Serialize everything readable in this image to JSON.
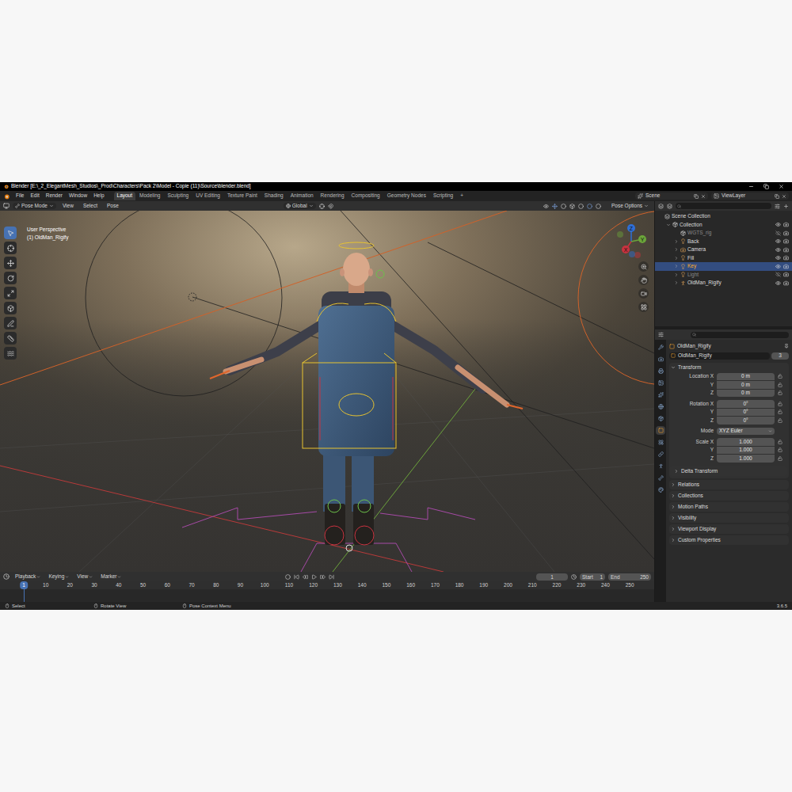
{
  "window": {
    "title": "Blender [E:\\_2_ElegantMesh_Studios\\_Prod\\Characters\\Pack 2\\Model - Copie (11)\\Source\\blender.blend]"
  },
  "top_bar": {
    "menus": [
      "File",
      "Edit",
      "Render",
      "Window",
      "Help"
    ],
    "workspaces": [
      {
        "label": "Layout",
        "selected": true
      },
      {
        "label": "Modeling",
        "selected": false
      },
      {
        "label": "Sculpting",
        "selected": false
      },
      {
        "label": "UV Editing",
        "selected": false
      },
      {
        "label": "Texture Paint",
        "selected": false
      },
      {
        "label": "Shading",
        "selected": false
      },
      {
        "label": "Animation",
        "selected": false
      },
      {
        "label": "Rendering",
        "selected": false
      },
      {
        "label": "Compositing",
        "selected": false
      },
      {
        "label": "Geometry Nodes",
        "selected": false
      },
      {
        "label": "Scripting",
        "selected": false
      }
    ],
    "add_workspace": "+",
    "scene": "Scene",
    "view_layer": "ViewLayer"
  },
  "viewport_header": {
    "mode": "Pose Mode",
    "menus": [
      "View",
      "Select",
      "Pose"
    ],
    "orientation": "Global",
    "options": "Pose Options"
  },
  "viewport": {
    "view_name": "User Perspective",
    "active_object": "(1) OldMan_Rigify",
    "gizmo_axes": [
      {
        "label": "Z",
        "color": "#2f6fd6"
      },
      {
        "label": "Y",
        "color": "#6ba53a"
      },
      {
        "label": "X",
        "color": "#c8323f"
      }
    ],
    "tools": [
      {
        "kind": "select",
        "selected": true
      },
      {
        "kind": "cursor",
        "selected": false
      },
      {
        "kind": "move",
        "selected": false
      },
      {
        "kind": "rotate",
        "selected": false
      },
      {
        "kind": "scale",
        "selected": false
      },
      {
        "kind": "transform",
        "selected": false
      },
      {
        "kind": "annotate",
        "selected": false
      },
      {
        "kind": "measure",
        "selected": false
      },
      {
        "kind": "relax",
        "selected": false
      }
    ]
  },
  "timeline": {
    "menus": [
      "Playback",
      "Keying",
      "View",
      "Marker"
    ],
    "current_frame": "1",
    "start_label": "Start",
    "start": "1",
    "end_label": "End",
    "end": "250",
    "playhead": "1",
    "ticks": [
      "10",
      "20",
      "30",
      "40",
      "50",
      "60",
      "70",
      "80",
      "90",
      "100",
      "110",
      "120",
      "130",
      "140",
      "150",
      "160",
      "170",
      "180",
      "190",
      "200",
      "210",
      "220",
      "230",
      "240",
      "250"
    ]
  },
  "status_bar": {
    "hints": [
      "Select",
      "Rotate View",
      "Pose Context Menu"
    ],
    "version": "3.6.5"
  },
  "outliner": {
    "items": [
      {
        "label": "Scene Collection",
        "depth": 0,
        "kind": "scene",
        "expandable": false,
        "expanded": false,
        "selected": false,
        "hidden": false
      },
      {
        "label": "Collection",
        "depth": 1,
        "kind": "collection",
        "expandable": true,
        "expanded": true,
        "selected": false,
        "hidden": false
      },
      {
        "label": "WGTS_rig",
        "depth": 2,
        "kind": "collection",
        "expandable": false,
        "expanded": false,
        "selected": false,
        "hidden": true
      },
      {
        "label": "Back",
        "depth": 2,
        "kind": "light",
        "expandable": true,
        "expanded": false,
        "selected": false,
        "hidden": false
      },
      {
        "label": "Camera",
        "depth": 2,
        "kind": "camera",
        "expandable": true,
        "expanded": false,
        "selected": false,
        "hidden": false
      },
      {
        "label": "Fill",
        "depth": 2,
        "kind": "light",
        "expandable": true,
        "expanded": false,
        "selected": false,
        "hidden": false
      },
      {
        "label": "Key",
        "depth": 2,
        "kind": "light",
        "expandable": true,
        "expanded": false,
        "selected": true,
        "hidden": false
      },
      {
        "label": "Light",
        "depth": 2,
        "kind": "light",
        "expandable": true,
        "expanded": false,
        "selected": false,
        "hidden": true
      },
      {
        "label": "OldMan_Rigify",
        "depth": 2,
        "kind": "armature",
        "expandable": true,
        "expanded": false,
        "selected": false,
        "hidden": false
      }
    ]
  },
  "properties": {
    "tabs": [
      {
        "kind": "tool",
        "selected": false
      },
      {
        "kind": "render",
        "selected": false
      },
      {
        "kind": "output",
        "selected": false
      },
      {
        "kind": "view_layer",
        "selected": false
      },
      {
        "kind": "scene",
        "selected": false
      },
      {
        "kind": "world",
        "selected": false
      },
      {
        "kind": "collection",
        "selected": false
      },
      {
        "kind": "object",
        "selected": true
      },
      {
        "kind": "physics",
        "selected": false
      },
      {
        "kind": "constraints",
        "selected": false
      },
      {
        "kind": "data",
        "selected": false
      },
      {
        "kind": "bone",
        "selected": false
      },
      {
        "kind": "material",
        "selected": false
      }
    ],
    "object_name": "OldMan_Rigify",
    "datablock": "OldMan_Rigify",
    "users": "3",
    "transform": {
      "title": "Transform",
      "expanded": true,
      "groups": [
        {
          "kind": "vector",
          "rows": [
            {
              "label": "Location X",
              "value": "0 m",
              "locked": false
            },
            {
              "label": "Y",
              "value": "0 m",
              "locked": false
            },
            {
              "label": "Z",
              "value": "0 m",
              "locked": false
            }
          ]
        },
        {
          "kind": "vector",
          "rows": [
            {
              "label": "Rotation X",
              "value": "0°",
              "locked": false
            },
            {
              "label": "Y",
              "value": "0°",
              "locked": false
            },
            {
              "label": "Z",
              "value": "0°",
              "locked": false
            }
          ]
        },
        {
          "kind": "dropdown",
          "rows": [
            {
              "label": "Mode",
              "value": "XYZ Euler",
              "locked": false
            }
          ]
        },
        {
          "kind": "vector",
          "rows": [
            {
              "label": "Scale X",
              "value": "1.000",
              "locked": false
            },
            {
              "label": "Y",
              "value": "1.000",
              "locked": false
            },
            {
              "label": "Z",
              "value": "1.000",
              "locked": false
            }
          ]
        }
      ],
      "subpanel": {
        "title": "Delta Transform",
        "expanded": false
      }
    },
    "panels": [
      {
        "title": "Relations",
        "expanded": false
      },
      {
        "title": "Collections",
        "expanded": false
      },
      {
        "title": "Motion Paths",
        "expanded": false
      },
      {
        "title": "Visibility",
        "expanded": false
      },
      {
        "title": "Viewport Display",
        "expanded": false
      },
      {
        "title": "Custom Properties",
        "expanded": false
      }
    ]
  }
}
